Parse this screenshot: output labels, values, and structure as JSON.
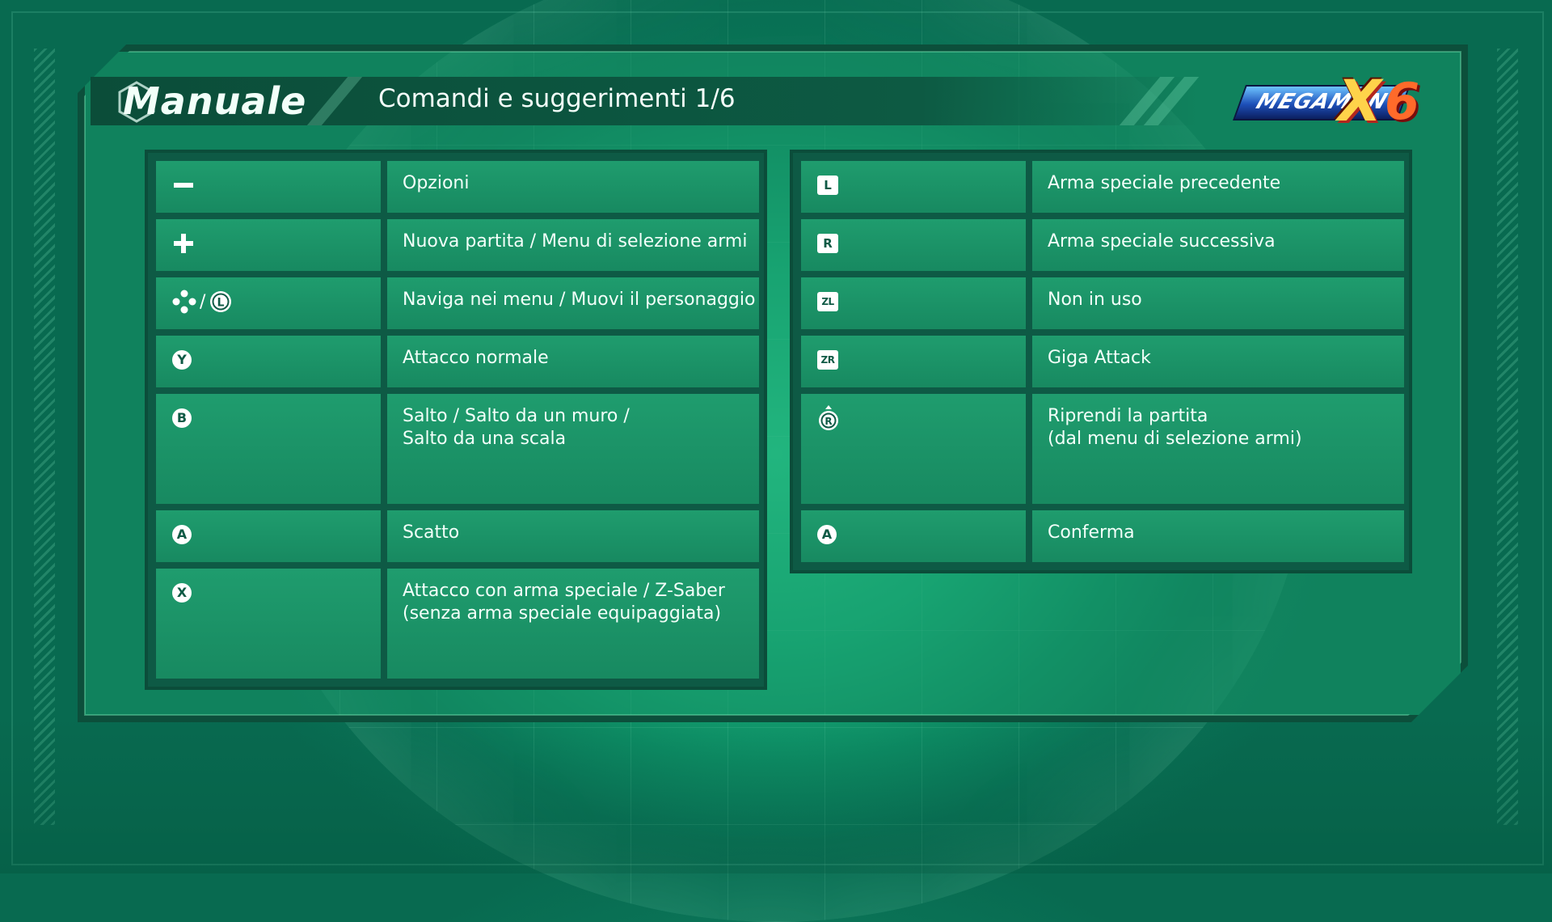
{
  "header": {
    "manual_title": "Manuale",
    "page_title": "Comandi e suggerimenti 1/6",
    "logo": {
      "mega": "MEGAMAN",
      "x": "X",
      "six": "6"
    }
  },
  "colors": {
    "accent": "#2fdc9a",
    "panel_border": "#0b4d3a",
    "cell": "#1c9a6b",
    "text": "#f2fff9"
  },
  "left_controls": [
    {
      "icon": "minus-button-icon",
      "key": "",
      "description": "Opzioni"
    },
    {
      "icon": "plus-button-icon",
      "key": "",
      "description": "Nuova partita / Menu di selezione armi"
    },
    {
      "icon": "dpad-icon",
      "key": "L",
      "description": "Naviga nei menu / Muovi il personaggio"
    },
    {
      "icon": "y-button-icon",
      "key": "Y",
      "description": "Attacco normale"
    },
    {
      "icon": "b-button-icon",
      "key": "B",
      "description": "Salto / Salto da un muro /\nSalto da una scala"
    },
    {
      "icon": "a-button-icon",
      "key": "A",
      "description": "Scatto"
    },
    {
      "icon": "x-button-icon",
      "key": "X",
      "description": "Attacco con arma speciale / Z-Saber\n(senza arma speciale equipaggiata)"
    }
  ],
  "right_controls": [
    {
      "icon": "l-button-icon",
      "key": "L",
      "description": "Arma speciale precedente"
    },
    {
      "icon": "r-button-icon",
      "key": "R",
      "description": "Arma speciale successiva"
    },
    {
      "icon": "zl-button-icon",
      "key": "ZL",
      "description": "Non in uso"
    },
    {
      "icon": "zr-button-icon",
      "key": "ZR",
      "description": "Giga Attack"
    },
    {
      "icon": "right-stick-press-icon",
      "key": "R",
      "description": "Riprendi la partita\n(dal menu di selezione armi)"
    },
    {
      "icon": "a-button-icon",
      "key": "A",
      "description": "Conferma"
    }
  ]
}
